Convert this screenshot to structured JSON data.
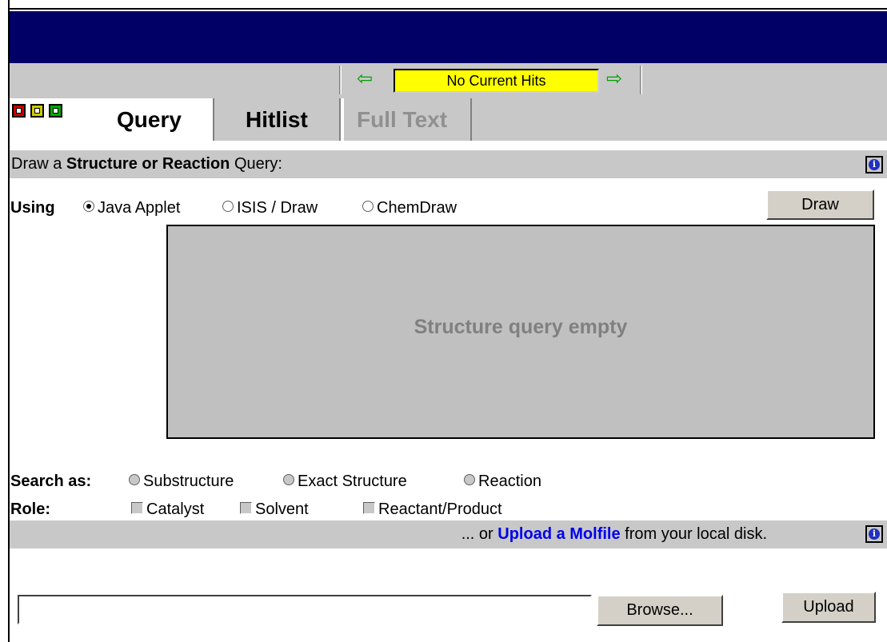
{
  "nav": {
    "back_arrow": "⇦",
    "forward_arrow": "⇨",
    "hits_status": "No Current Hits"
  },
  "window_buttons": [
    {
      "name": "red",
      "color": "#cc0000"
    },
    {
      "name": "yellow",
      "color": "#cccc00"
    },
    {
      "name": "green",
      "color": "#00aa00"
    }
  ],
  "tabs": {
    "query": "Query",
    "hitlist": "Hitlist",
    "full_text": "Full Text"
  },
  "query_section": {
    "prefix": "Draw a ",
    "bold": "Structure or Reaction",
    "suffix": " Query:",
    "info_icon": "i"
  },
  "using": {
    "label": "Using",
    "options": [
      "Java Applet",
      "ISIS / Draw",
      "ChemDraw"
    ],
    "selected": "Java Applet"
  },
  "draw_button": "Draw",
  "canvas": {
    "placeholder": "Structure query empty"
  },
  "search_as": {
    "label": "Search as:",
    "options": [
      "Substructure",
      "Exact Structure",
      "Reaction"
    ]
  },
  "role": {
    "label": "Role:",
    "options": [
      "Catalyst",
      "Solvent",
      "Reactant/Product"
    ]
  },
  "upload_section": {
    "prefix": "... or ",
    "link": "Upload a Molfile",
    "suffix": " from your local disk.",
    "info_icon": "i"
  },
  "file": {
    "value": "",
    "browse_label": "Browse...",
    "upload_label": "Upload"
  },
  "colors": {
    "title_bar": "#000066",
    "panel_gray": "#c8c8c8",
    "hits_bg": "#ffff00",
    "arrow": "#00a000",
    "link": "#0000ee"
  }
}
